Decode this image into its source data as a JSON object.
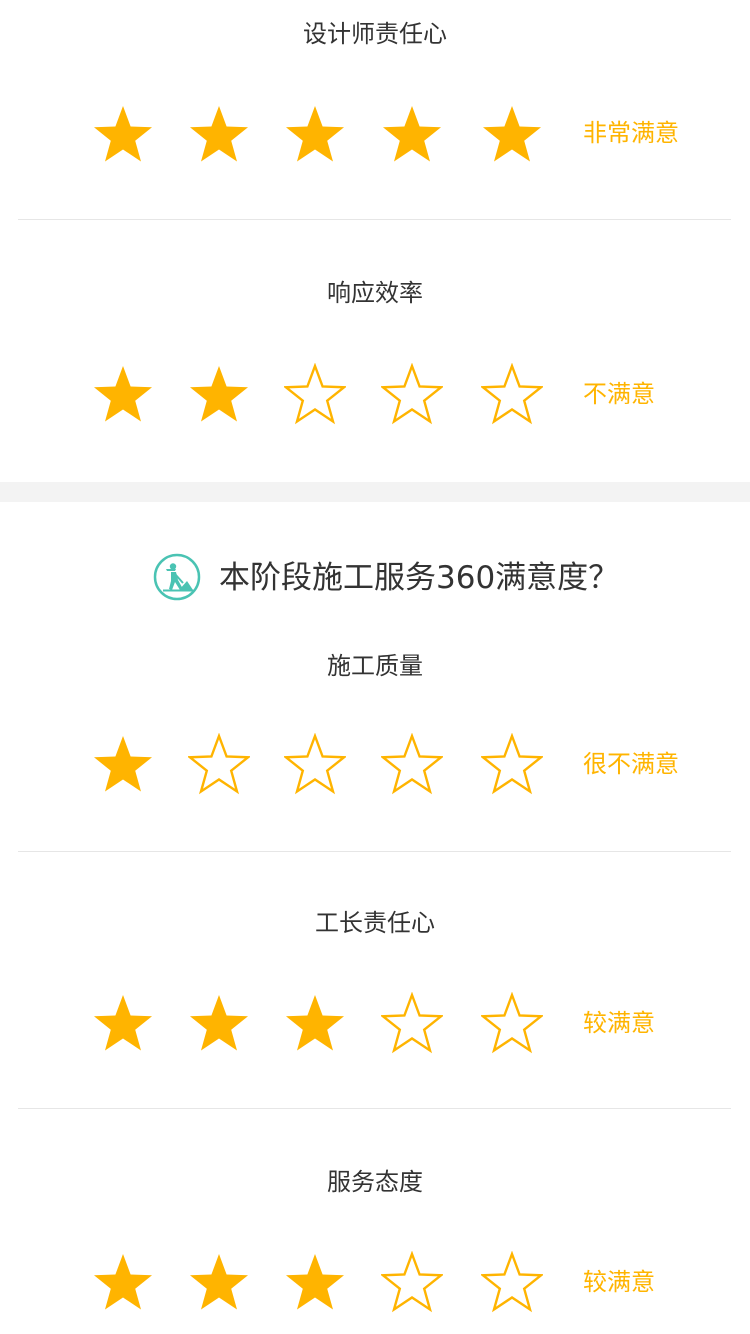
{
  "colors": {
    "accent": "#ffb400",
    "teal": "#4ac3b3",
    "divider": "#e6e6e6",
    "section_gap": "#f3f3f3"
  },
  "design_section": {
    "ratings": [
      {
        "title": "设计师责任心",
        "score": 5,
        "max": 5,
        "label": "非常满意"
      },
      {
        "title": "响应效率",
        "score": 2,
        "max": 5,
        "label": "不满意"
      }
    ]
  },
  "construction_section": {
    "icon": "construction-worker-icon",
    "heading": "本阶段施工服务360满意度？",
    "ratings": [
      {
        "title": "施工质量",
        "score": 1,
        "max": 5,
        "label": "很不满意"
      },
      {
        "title": "工长责任心",
        "score": 3,
        "max": 5,
        "label": "较满意"
      },
      {
        "title": "服务态度",
        "score": 3,
        "max": 5,
        "label": "较满意"
      }
    ]
  }
}
